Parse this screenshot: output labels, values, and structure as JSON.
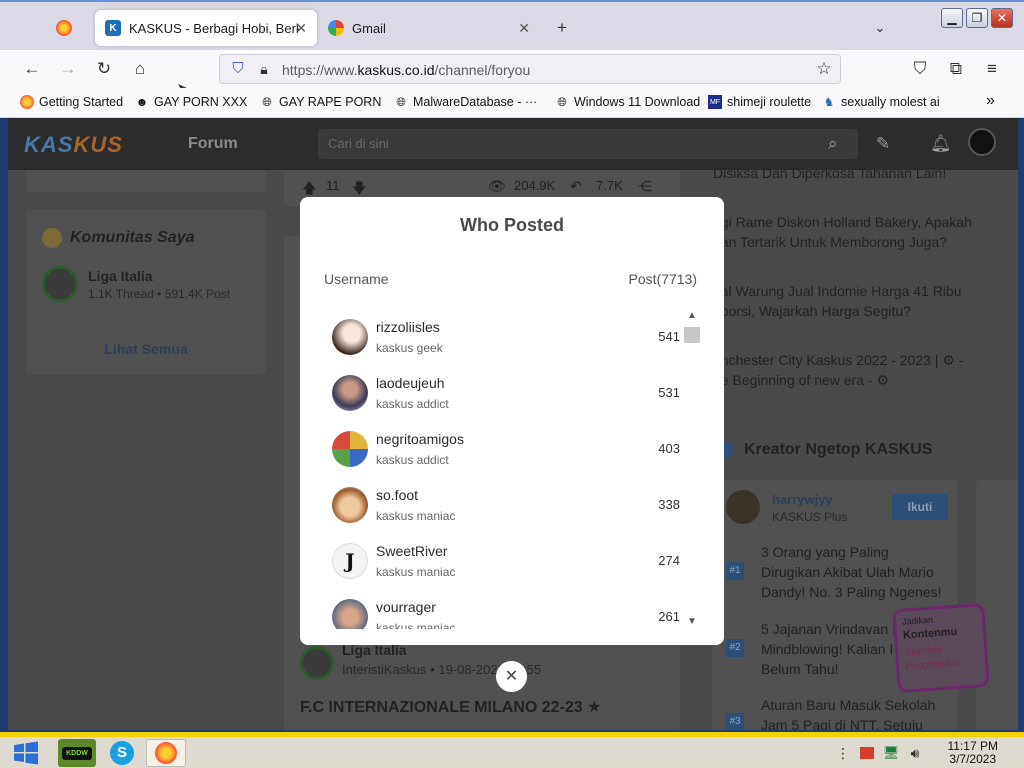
{
  "browser": {
    "tabs": [
      {
        "title": "",
        "icon": "firefox-icon"
      },
      {
        "title": "KASKUS - Berbagi Hobi, Berk",
        "icon": "kaskus-icon"
      },
      {
        "title": "Gmail",
        "icon": "google-icon"
      }
    ],
    "url_prefix": "https://www.",
    "url_domain": "kaskus.co.id",
    "url_path": "/channel/foryou",
    "bookmarks": [
      "Getting Started",
      "GAY PORN XXX",
      "GAY RAPE PORN",
      "MalwareDatabase - ···",
      "Windows 11 Download",
      "shimeji roulette",
      "sexually molest ai"
    ]
  },
  "kaskus": {
    "logo_part1": "KAS",
    "logo_part2": "KUS",
    "forum_label": "Forum",
    "search_placeholder": "Cari di sini",
    "post_stats": {
      "votes": "11",
      "views": "204.9K",
      "shares": "7.7K"
    },
    "komunitas_title": "Komunitas Saya",
    "community": {
      "name": "Liga Italia",
      "meta": "1.1K Thread • 591.4K Post"
    },
    "lihat_semua": "Lihat Semua",
    "headlines": [
      "Disiksa Dan Diperkosa Tahanan Lain!",
      "agi Rame Diskon Holland Bakery, Apakah",
      "gan Tertarik Untuk Memborong Juga?",
      "iral Warung Jual Indomie Harga 41 Ribu",
      "eporsi, Wajarkah Harga Segitu?",
      "anchester City Kaskus 2022 - 2023 | ⚙ -",
      "he Beginning of new era - ⚙"
    ],
    "kreator_title": "Kreator Ngetop KASKUS",
    "kreator": {
      "name": "harrywjyy",
      "badge": "KASKUS Plus",
      "follow": "Ikuti"
    },
    "ranked": [
      {
        "n": "#1",
        "text1": "3 Orang yang Paling",
        "text2": "Dirugikan Akibat Ulah Mario",
        "text3": "Dandy! No. 3 Paling Ngenes!"
      },
      {
        "n": "#2",
        "text1": "5 Jajanan Vrindavan I",
        "text2": "Mindblowing! Kalian I",
        "text3": "Belum Tahu!"
      },
      {
        "n": "#3",
        "text1": "Aturan Baru Masuk Sekolah",
        "text2": "Jam 5 Pagi di NTT, Setuju",
        "text3": ""
      }
    ],
    "post_footer": {
      "community": "Liga Italia",
      "author": "InteristiKaskus",
      "date": "• 19-08-2022 19:55",
      "title": "F.C INTERNAZIONALE MILANO 22-23 ★"
    },
    "promo": {
      "line1": "Jadikan",
      "line2": "Kontenmu",
      "line3": "Sumber",
      "line4": "Penghasilan"
    }
  },
  "modal": {
    "title": "Who Posted",
    "col_username": "Username",
    "col_post": "Post(7713)",
    "posters": [
      {
        "username": "rizzoliisles",
        "rank": "kaskus geek",
        "count": "541",
        "color": "#e9d8cc"
      },
      {
        "username": "laodeujeuh",
        "rank": "kaskus addict",
        "count": "531",
        "color": "#8b5a5a"
      },
      {
        "username": "negritoamigos",
        "rank": "kaskus addict",
        "count": "403",
        "color": "#6a9a4a"
      },
      {
        "username": "so.foot",
        "rank": "kaskus maniac",
        "count": "338",
        "color": "#e8b37a"
      },
      {
        "username": "SweetRiver",
        "rank": "kaskus maniac",
        "count": "274",
        "color": "#f2f2f2"
      },
      {
        "username": "vourrager",
        "rank": "kaskus maniac",
        "count": "261",
        "color": "#6d7f94"
      }
    ]
  },
  "taskbar": {
    "time": "11:17 PM",
    "date": "3/7/2023"
  }
}
